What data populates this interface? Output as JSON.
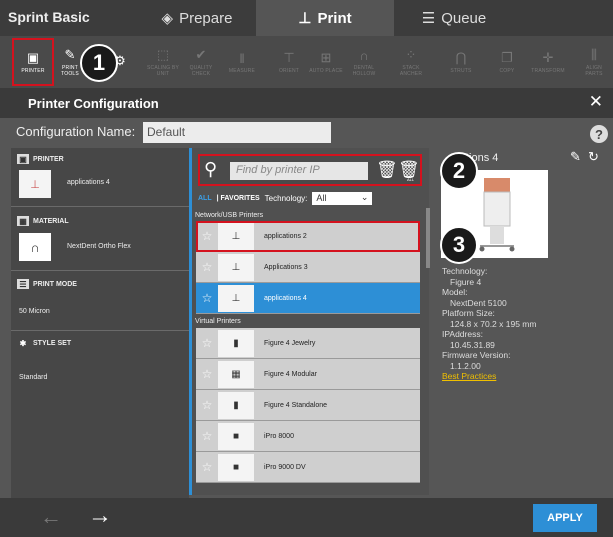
{
  "app": {
    "title": "Sprint Basic"
  },
  "tabs": [
    {
      "label": "Prepare",
      "icon": "shield-icon"
    },
    {
      "label": "Print",
      "icon": "printer-icon"
    },
    {
      "label": "Queue",
      "icon": "list-icon"
    }
  ],
  "toolbar": [
    {
      "label": "PRINTER",
      "icon": "printer-icon"
    },
    {
      "label": "PRINT TOOLS",
      "icon": "tools-icon"
    },
    {
      "label": "",
      "icon": "settings-icon"
    },
    {
      "label": "SCALING BY UNIT",
      "icon": "scale-icon"
    },
    {
      "label": "QUALITY CHECK",
      "icon": "check-icon"
    },
    {
      "label": "MEASURE",
      "icon": "measure-icon"
    },
    {
      "label": "ORIENT",
      "icon": "orient-icon"
    },
    {
      "label": "AUTO PLACE",
      "icon": "grid-icon"
    },
    {
      "label": "DENTAL HOLLOW",
      "icon": "arch-icon"
    },
    {
      "label": "STACK ANCHER",
      "icon": "stack-icon"
    },
    {
      "label": "STRUTS",
      "icon": "arch-icon"
    },
    {
      "label": "COPY",
      "icon": "copy-icon"
    },
    {
      "label": "TRANSFORM",
      "icon": "move-icon"
    },
    {
      "label": "ALIGN PARTS",
      "icon": "align-icon"
    }
  ],
  "callouts": [
    "1",
    "2",
    "3"
  ],
  "dialog": {
    "title": "Printer Configuration",
    "close": "✕",
    "config_label": "Configuration Name:",
    "config_value": "Default",
    "help": "?"
  },
  "sections": {
    "printer": {
      "label": "PRINTER",
      "value": "applications 4"
    },
    "material": {
      "label": "MATERIAL",
      "value": "NextDent Ortho Flex"
    },
    "print_mode": {
      "label": "PRINT MODE",
      "value": "50 Micron"
    },
    "style_set": {
      "label": "STYLE SET",
      "value": "Standard"
    }
  },
  "search": {
    "placeholder": "Find by printer IP",
    "trash_label": "ALL"
  },
  "filters": {
    "all": "ALL",
    "favorites": "| FAVORITES",
    "tech_label": "Technology:",
    "tech_value": "All"
  },
  "groups": {
    "network": "Network/USB Printers",
    "virtual": "Virtual Printers"
  },
  "printers_network": [
    "applications 2",
    "Applications 3",
    "applications 4"
  ],
  "printers_virtual": [
    "Figure 4 Jewelry",
    "Figure 4 Modular",
    "Figure 4 Standalone",
    "iPro 8000",
    "iPro 9000 DV"
  ],
  "details": {
    "name": "tions 4",
    "tech_label": "Technology:",
    "tech": "Figure 4",
    "model_label": "Model:",
    "model": "NextDent 5100",
    "platform_label": "Platform Size:",
    "platform": "124.8 x 70.2 x 195 mm",
    "ip_label": "IPAddress:",
    "ip": "10.45.31.89",
    "fw_label": "Firmware Version:",
    "fw": "1.1.2.00",
    "best": "Best Practices"
  },
  "footer": {
    "apply": "APPLY",
    "back": "←",
    "next": "→"
  }
}
